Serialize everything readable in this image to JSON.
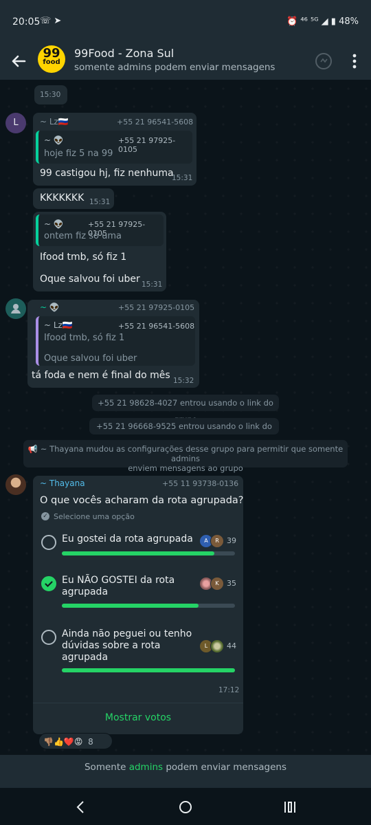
{
  "status_bar": {
    "time": "20:05",
    "left_icons": "☏ ➤",
    "right_icons": "⏰ ⁴⁶ ⁵ᴳ ◢ ▮",
    "battery": "48%"
  },
  "header": {
    "avatar_top": "99",
    "avatar_bottom": "food",
    "title": "99Food - Zona Sul",
    "subtitle": "somente admins podem enviar mensagens"
  },
  "chat": {
    "first_time": "15:30",
    "msg1": {
      "avatar_letter": "L",
      "sender": "~ Lz🇷🇺",
      "phone": "+55 21 96541-5608",
      "quote_name": "~ 👽",
      "quote_phone": "+55 21 97925-0105",
      "quote_text": "hoje fiz 5 na 99",
      "text": "99 castigou hj, fiz nenhuma",
      "time": "15:31"
    },
    "msg2": {
      "text": "KKKKKKK",
      "time": "15:31"
    },
    "msg3": {
      "quote_name": "~ 👽",
      "quote_phone": "+55 21 97925-0105",
      "quote_text": "ontem fiz só uma",
      "line1": "Ifood tmb, só fiz 1",
      "line2": "Oque salvou foi uber",
      "time": "15:31"
    },
    "msg4": {
      "sender": "~ 👽",
      "phone": "+55 21 97925-0105",
      "quote_name": "~ Lz🇷🇺",
      "quote_phone": "+55 21 96541-5608",
      "quote_line1": "Ifood tmb, só fiz 1",
      "quote_line2": "Oque salvou foi uber",
      "text": "tá foda e nem é final do mês",
      "time": "15:32"
    },
    "sys1": "+55 21 98628-4027 entrou usando o link do grupo",
    "sys2": "+55 21 96668-9525 entrou usando o link do grupo",
    "sys3_line1": "📢 ~ Thayana mudou as configurações desse grupo para permitir que somente admins",
    "sys3_line2": "enviem mensagens ao grupo",
    "poll": {
      "sender": "~ Thayana",
      "phone": "+55 11 93738-0136",
      "question": "O que vocês acharam da rota agrupada?",
      "hint": "Selecione uma opção",
      "options": [
        {
          "label_line1": "Eu gostei da rota agrupada",
          "label_line2": "",
          "label_line3": "",
          "count": "39",
          "fraction": 0.88,
          "checked": false,
          "voters": [
            "A",
            "R"
          ]
        },
        {
          "label_line1": "Eu NÃO GOSTEI da rota",
          "label_line2": "agrupada",
          "label_line3": "",
          "count": "35",
          "fraction": 0.79,
          "checked": true,
          "voters": [
            "",
            "K"
          ]
        },
        {
          "label_line1": "Ainda não peguei ou tenho",
          "label_line2": "dúvidas sobre a rota",
          "label_line3": "agrupada",
          "count": "44",
          "fraction": 1.0,
          "checked": false,
          "voters": [
            "L",
            ""
          ]
        }
      ],
      "time": "17:12",
      "show_votes": "Mostrar votos",
      "reactions": "👎🏽👍❤️😡",
      "reaction_count": "8"
    }
  },
  "footer": {
    "prefix": "Somente ",
    "accent": "admins",
    "suffix": " podem enviar mensagens"
  },
  "colors": {
    "accent": "#25d366",
    "bubble": "#202c33",
    "background": "#0b141a",
    "header": "#1f2c34"
  }
}
